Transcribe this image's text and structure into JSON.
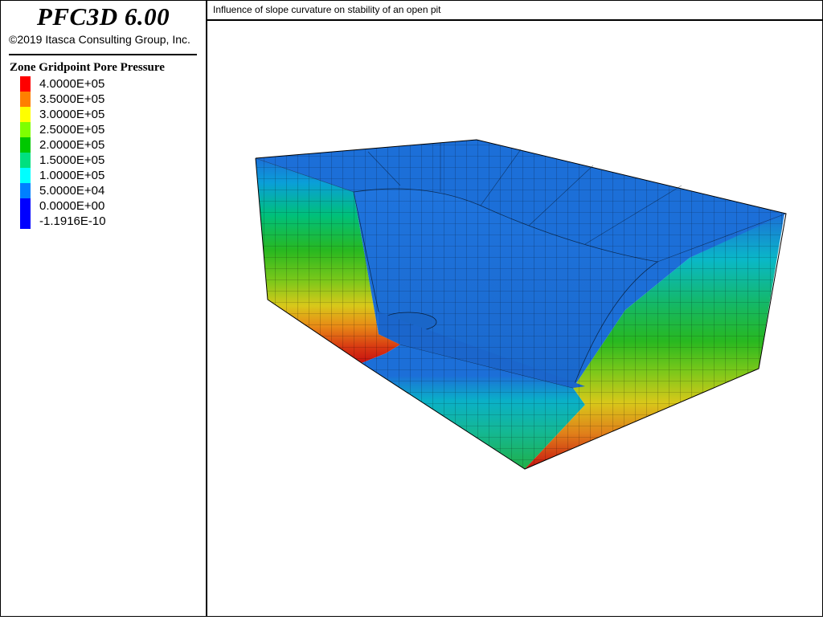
{
  "header": {
    "app_title": "PFC3D 6.00",
    "copyright": "©2019 Itasca Consulting Group, Inc.",
    "subtitle": "Influence of slope curvature on stability of an open pit"
  },
  "legend": {
    "title": "Zone Gridpoint Pore Pressure",
    "items": [
      {
        "label": "4.0000E+05",
        "color": "#ff0000"
      },
      {
        "label": "3.5000E+05",
        "color": "#ff7f00"
      },
      {
        "label": "3.0000E+05",
        "color": "#ffff00"
      },
      {
        "label": "2.5000E+05",
        "color": "#7fff00"
      },
      {
        "label": "2.0000E+05",
        "color": "#00c800"
      },
      {
        "label": "1.5000E+05",
        "color": "#00e080"
      },
      {
        "label": "1.0000E+05",
        "color": "#00ffff"
      },
      {
        "label": "5.0000E+04",
        "color": "#0080ff"
      },
      {
        "label": "0.0000E+00",
        "color": "#0000ff"
      },
      {
        "label": "-1.1916E-10",
        "color": "#0000ff"
      }
    ]
  },
  "model": {
    "top_color": "#1c6fd8",
    "edge_color": "#000000"
  }
}
